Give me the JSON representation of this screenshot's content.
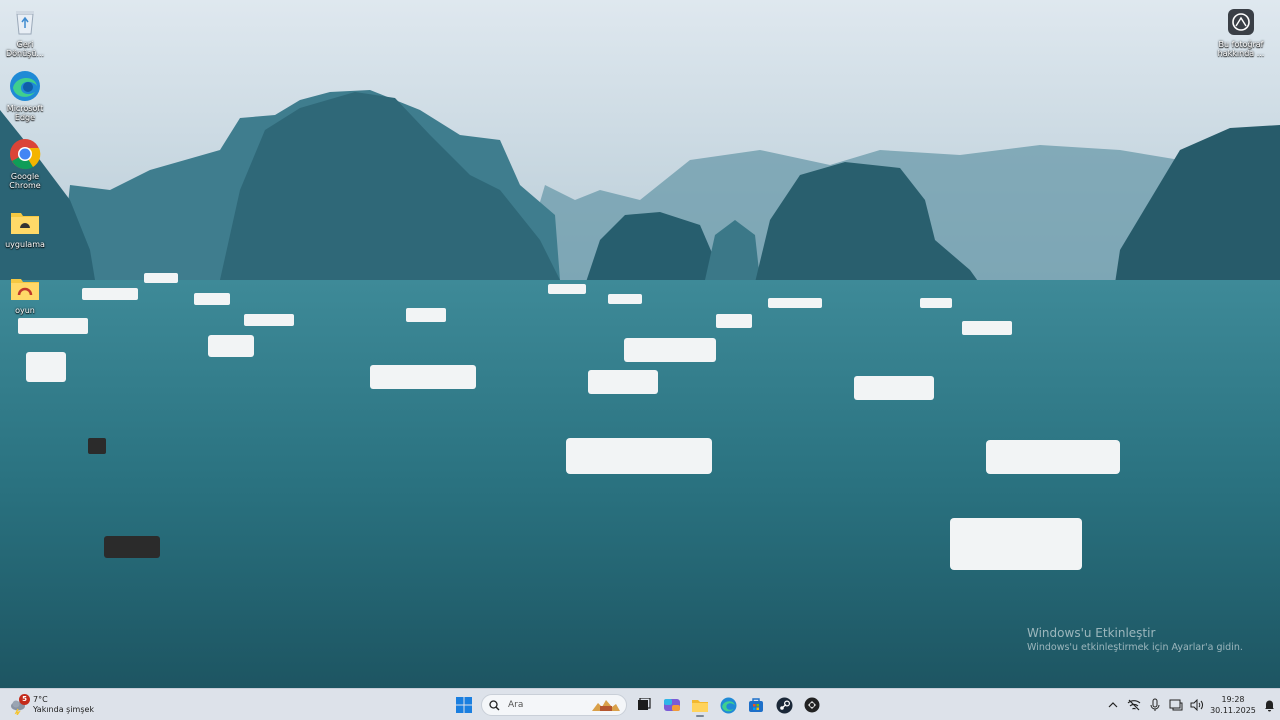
{
  "desktop": {
    "icons": [
      {
        "label": "Geri Dönüşü...",
        "icon": "recycle-bin-icon"
      },
      {
        "label": "Microsoft Edge",
        "icon": "edge-icon"
      },
      {
        "label": "Google Chrome",
        "icon": "chrome-icon"
      },
      {
        "label": "uygulama",
        "icon": "folder-icon"
      },
      {
        "label": "oyun",
        "icon": "folder-icon"
      }
    ],
    "spotlight": {
      "label": "Bu fotoğraf hakkında ...",
      "icon": "camera-icon"
    },
    "watermark": {
      "title": "Windows'u Etkinleştir",
      "subtitle": "Windows'u etkinleştirmek için Ayarlar'a gidin."
    }
  },
  "taskbar": {
    "weather": {
      "badge": "5",
      "temp": "7°C",
      "desc": "Yakında şimşek"
    },
    "search_placeholder": "Ara",
    "apps": [
      "start-icon",
      "task-view-icon",
      "copilot-icon",
      "file-explorer-icon",
      "edge-icon",
      "store-icon",
      "steam-icon",
      "app-icon"
    ],
    "clock": {
      "time": "19:28",
      "date": "30.11.2025"
    },
    "colors": {
      "bar": "#dde2ea",
      "badge": "#c42b1c"
    }
  }
}
